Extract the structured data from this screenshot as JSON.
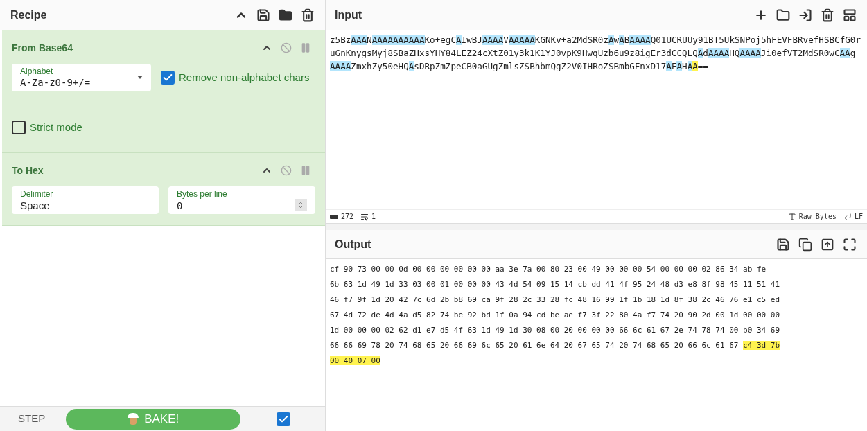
{
  "recipe": {
    "title": "Recipe",
    "operations": [
      {
        "name": "From Base64",
        "args": [
          {
            "kind": "select",
            "label": "Alphabet",
            "value": "A-Za-z0-9+/="
          },
          {
            "kind": "checkbox",
            "label": "Remove non-alphabet chars",
            "checked": true
          },
          {
            "kind": "checkbox",
            "label": "Strict mode",
            "checked": false
          }
        ]
      },
      {
        "name": "To Hex",
        "args": [
          {
            "kind": "text",
            "label": "Delimiter",
            "value": "Space"
          },
          {
            "kind": "number",
            "label": "Bytes per line",
            "value": "0"
          }
        ]
      }
    ]
  },
  "controls": {
    "step": "STEP",
    "bake": "BAKE!",
    "auto_bake": {
      "checked": true
    }
  },
  "input": {
    "title": "Input",
    "lines": [
      [
        {
          "text": "z5Bz",
          "kind": "plain"
        },
        {
          "text": "AAA",
          "kind": "match"
        },
        {
          "text": "N",
          "kind": "plain"
        },
        {
          "text": "AAAAAAAAAA",
          "kind": "match"
        },
        {
          "text": "Ko+egC",
          "kind": "plain"
        },
        {
          "text": "A",
          "kind": "match"
        },
        {
          "text": "IwBJ",
          "kind": "plain"
        },
        {
          "text": "AAAA",
          "kind": "match"
        },
        {
          "text": "V",
          "kind": "plain"
        },
        {
          "text": "AAAAA",
          "kind": "match"
        },
        {
          "text": "KGNKv+a2MdSR0z",
          "kind": "plain"
        },
        {
          "text": "A",
          "kind": "match"
        },
        {
          "text": "w",
          "kind": "plain"
        },
        {
          "text": "A",
          "kind": "match"
        },
        {
          "text": "B",
          "kind": "plain"
        },
        {
          "text": "AAAA",
          "kind": "match"
        },
        {
          "text": "Q01UCRUUy91BT5UkSNPoj5hFEVFBRvefHSBCfG0r",
          "kind": "plain"
        }
      ],
      [
        {
          "text": "uGnKnygsMyj8SBaZHxsYHY84LEZ24cXtZ01y3k1K1YJ0vpK9HwqUzb6u9z8igEr3dCCQLQ",
          "kind": "plain"
        },
        {
          "text": "A",
          "kind": "match"
        },
        {
          "text": "d",
          "kind": "plain"
        },
        {
          "text": "AAAA",
          "kind": "match"
        },
        {
          "text": "HQ",
          "kind": "plain"
        },
        {
          "text": "AAAA",
          "kind": "match"
        },
        {
          "text": "Ji0efVT2MdSR0wC",
          "kind": "plain"
        },
        {
          "text": "AA",
          "kind": "match"
        },
        {
          "text": "g",
          "kind": "plain"
        }
      ],
      [
        {
          "text": "AAAA",
          "kind": "match"
        },
        {
          "text": "ZmxhZy50eHQ",
          "kind": "plain"
        },
        {
          "text": "A",
          "kind": "match"
        },
        {
          "text": "sDRpZmZpeCB0aGUgZmlsZSBhbmQgZ2V0IHRoZSBmbGFnxD17",
          "kind": "plain"
        },
        {
          "text": "A",
          "kind": "match"
        },
        {
          "text": "E",
          "kind": "plain"
        },
        {
          "text": "A",
          "kind": "match"
        },
        {
          "text": "H",
          "kind": "plain"
        },
        {
          "text": "A",
          "kind": "match"
        },
        {
          "text": "A",
          "kind": "selection"
        },
        {
          "text": "==",
          "kind": "plain"
        }
      ]
    ]
  },
  "status": {
    "length": "272",
    "lines": "1",
    "encoding": "Raw Bytes",
    "eol": "LF"
  },
  "output": {
    "title": "Output",
    "lines": [
      [
        {
          "text": "cf 90 73 00 00 0d 00 00 00 00 00 00 aa 3e 7a 00 80 23 00 49 00 00 00 54 00 00 00 02 86 34 ab fe",
          "kind": "plain"
        }
      ],
      [
        {
          "text": "6b 63 1d 49 1d 33 03 00 01 00 00 00 43 4d 54 09 15 14 cb dd 41 4f 95 24 48 d3 e8 8f 98 45 11 51 41",
          "kind": "plain"
        }
      ],
      [
        {
          "text": "46 f7 9f 1d 20 42 7c 6d 2b b8 69 ca 9f 28 2c 33 28 fc 48 16 99 1f 1b 18 1d 8f 38 2c 46 76 e1 c5 ed",
          "kind": "plain"
        }
      ],
      [
        {
          "text": "67 4d 72 de 4d 4a d5 82 74 be 92 bd 1f 0a 94 cd be ae f7 3f 22 80 4a f7 74 20 90 2d 00 1d 00 00 00",
          "kind": "plain"
        }
      ],
      [
        {
          "text": "1d 00 00 00 02 62 d1 e7 d5 4f 63 1d 49 1d 30 08 00 20 00 00 00 66 6c 61 67 2e 74 78 74 00 b0 34 69",
          "kind": "plain"
        }
      ],
      [
        {
          "text": "66 66 69 78 20 74 68 65 20 66 69 6c 65 20 61 6e 64 20 67 65 74 20 74 68 65 20 66 6c 61 67 ",
          "kind": "plain"
        },
        {
          "text": "c4 3d 7b",
          "kind": "selection"
        }
      ],
      [
        {
          "text": "00 40 07 00",
          "kind": "selection"
        }
      ]
    ]
  }
}
